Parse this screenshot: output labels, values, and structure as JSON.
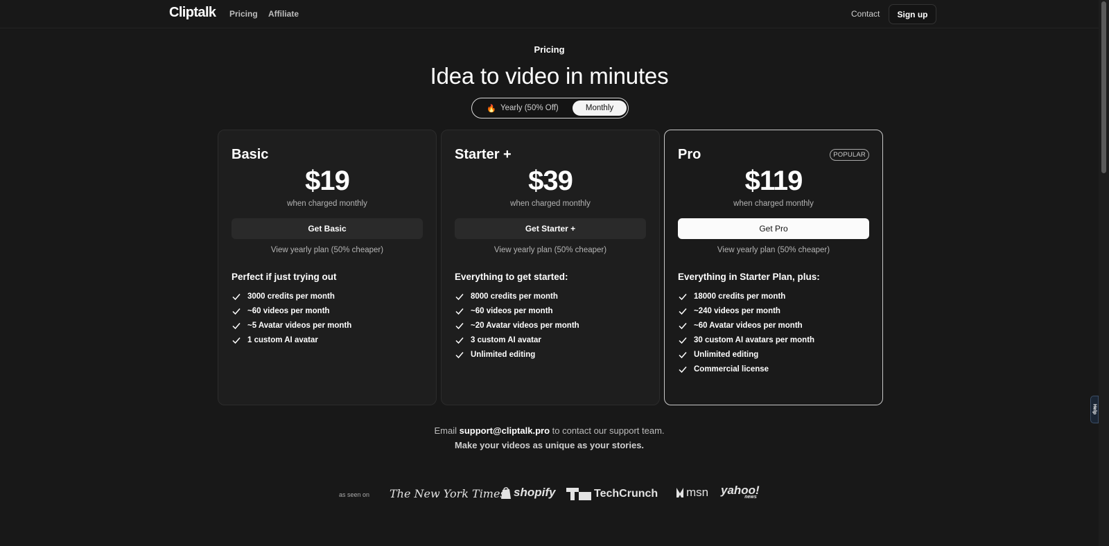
{
  "nav": {
    "logo": "Cliptalk",
    "links": [
      "Pricing",
      "Affiliate"
    ],
    "contact": "Contact",
    "signup": "Sign up"
  },
  "hero": {
    "eyebrow": "Pricing",
    "headline": "Idea to video in minutes"
  },
  "billing_toggle": {
    "yearly": "Yearly (50% Off)",
    "monthly": "Monthly",
    "selected": "Monthly"
  },
  "plans": [
    {
      "name": "Basic",
      "price": "$19",
      "price_note": "when charged monthly",
      "cta": "Get Basic",
      "yearly_link": "View yearly plan (50% cheaper)",
      "features_title": "Perfect if just trying out",
      "features": [
        "3000 credits per month",
        "~60 videos per month",
        "~5 Avatar videos per month",
        "1 custom AI avatar"
      ]
    },
    {
      "name": "Starter +",
      "price": "$39",
      "price_note": "when charged monthly",
      "cta": "Get Starter +",
      "yearly_link": "View yearly plan (50% cheaper)",
      "features_title": "Everything to get started:",
      "features": [
        "8000 credits per month",
        "~60 videos per month",
        "~20 Avatar videos per month",
        "3 custom AI avatar",
        "Unlimited editing"
      ]
    },
    {
      "name": "Pro",
      "badge": "POPULAR",
      "price": "$119",
      "price_note": "when charged monthly",
      "cta": "Get Pro",
      "yearly_link": "View yearly plan (50% cheaper)",
      "features_title": "Everything in Starter Plan, plus:",
      "features": [
        "18000 credits per month",
        "~240 videos per month",
        "~60 Avatar videos per month",
        "30 custom AI avatars per month",
        "Unlimited editing",
        "Commercial license"
      ]
    }
  ],
  "support": {
    "prefix": "Email",
    "email": "support@cliptalk.pro",
    "suffix": "to contact our support team.",
    "tagline": "Make your videos as unique as your stories."
  },
  "press": {
    "label": "as seen on",
    "logos": [
      "The New York Times",
      "shopify",
      "TechCrunch",
      "msn",
      "yahoo!",
      "news"
    ]
  },
  "help_tab": "Help",
  "icons": {
    "feature": "check-icon",
    "yearly": "fire-icon"
  }
}
